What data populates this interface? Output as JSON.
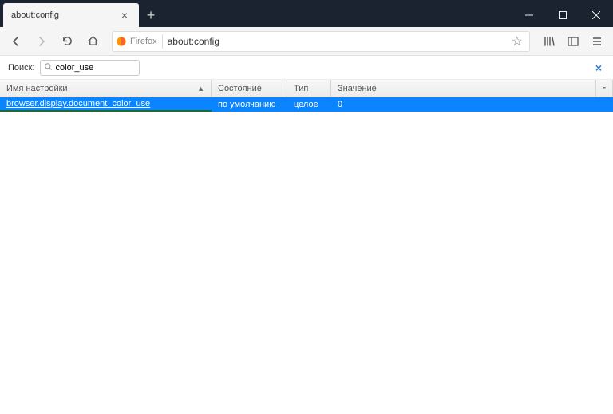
{
  "tab": {
    "title": "about:config"
  },
  "urlbar": {
    "identity_label": "Firefox",
    "url": "about:config"
  },
  "search": {
    "label": "Поиск:",
    "value": "color_use"
  },
  "columns": {
    "name": "Имя настройки",
    "state": "Состояние",
    "type": "Тип",
    "value": "Значение"
  },
  "rows": [
    {
      "name": "browser.display.document_color_use",
      "state": "по умолчанию",
      "type": "целое",
      "value": "0"
    }
  ]
}
